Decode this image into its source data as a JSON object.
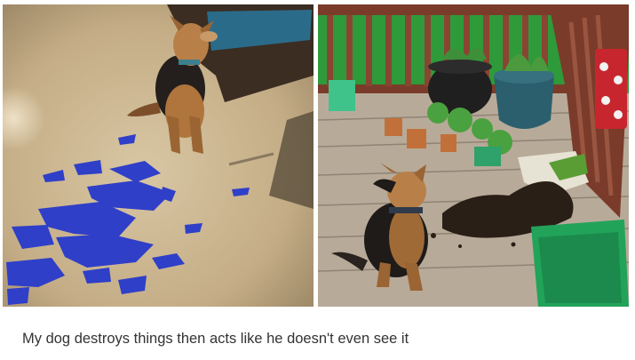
{
  "caption": "My dog destroys things then acts like he doesn't even see it",
  "photos": [
    {
      "scene": "dog sitting on carpet beside torn blue paper scraps"
    },
    {
      "scene": "dog sitting on wooden deck beside spilled potting soil and overturned planters"
    }
  ],
  "colors": {
    "carpet": "#c9b48f",
    "blue_scraps": "#2f3fc8",
    "deck": "#b9ab9a",
    "railing": "#7a3b2a",
    "grass": "#2f9a3a",
    "soil": "#2a1f17",
    "green_bin": "#22a35a",
    "caption_text": "#333333"
  }
}
